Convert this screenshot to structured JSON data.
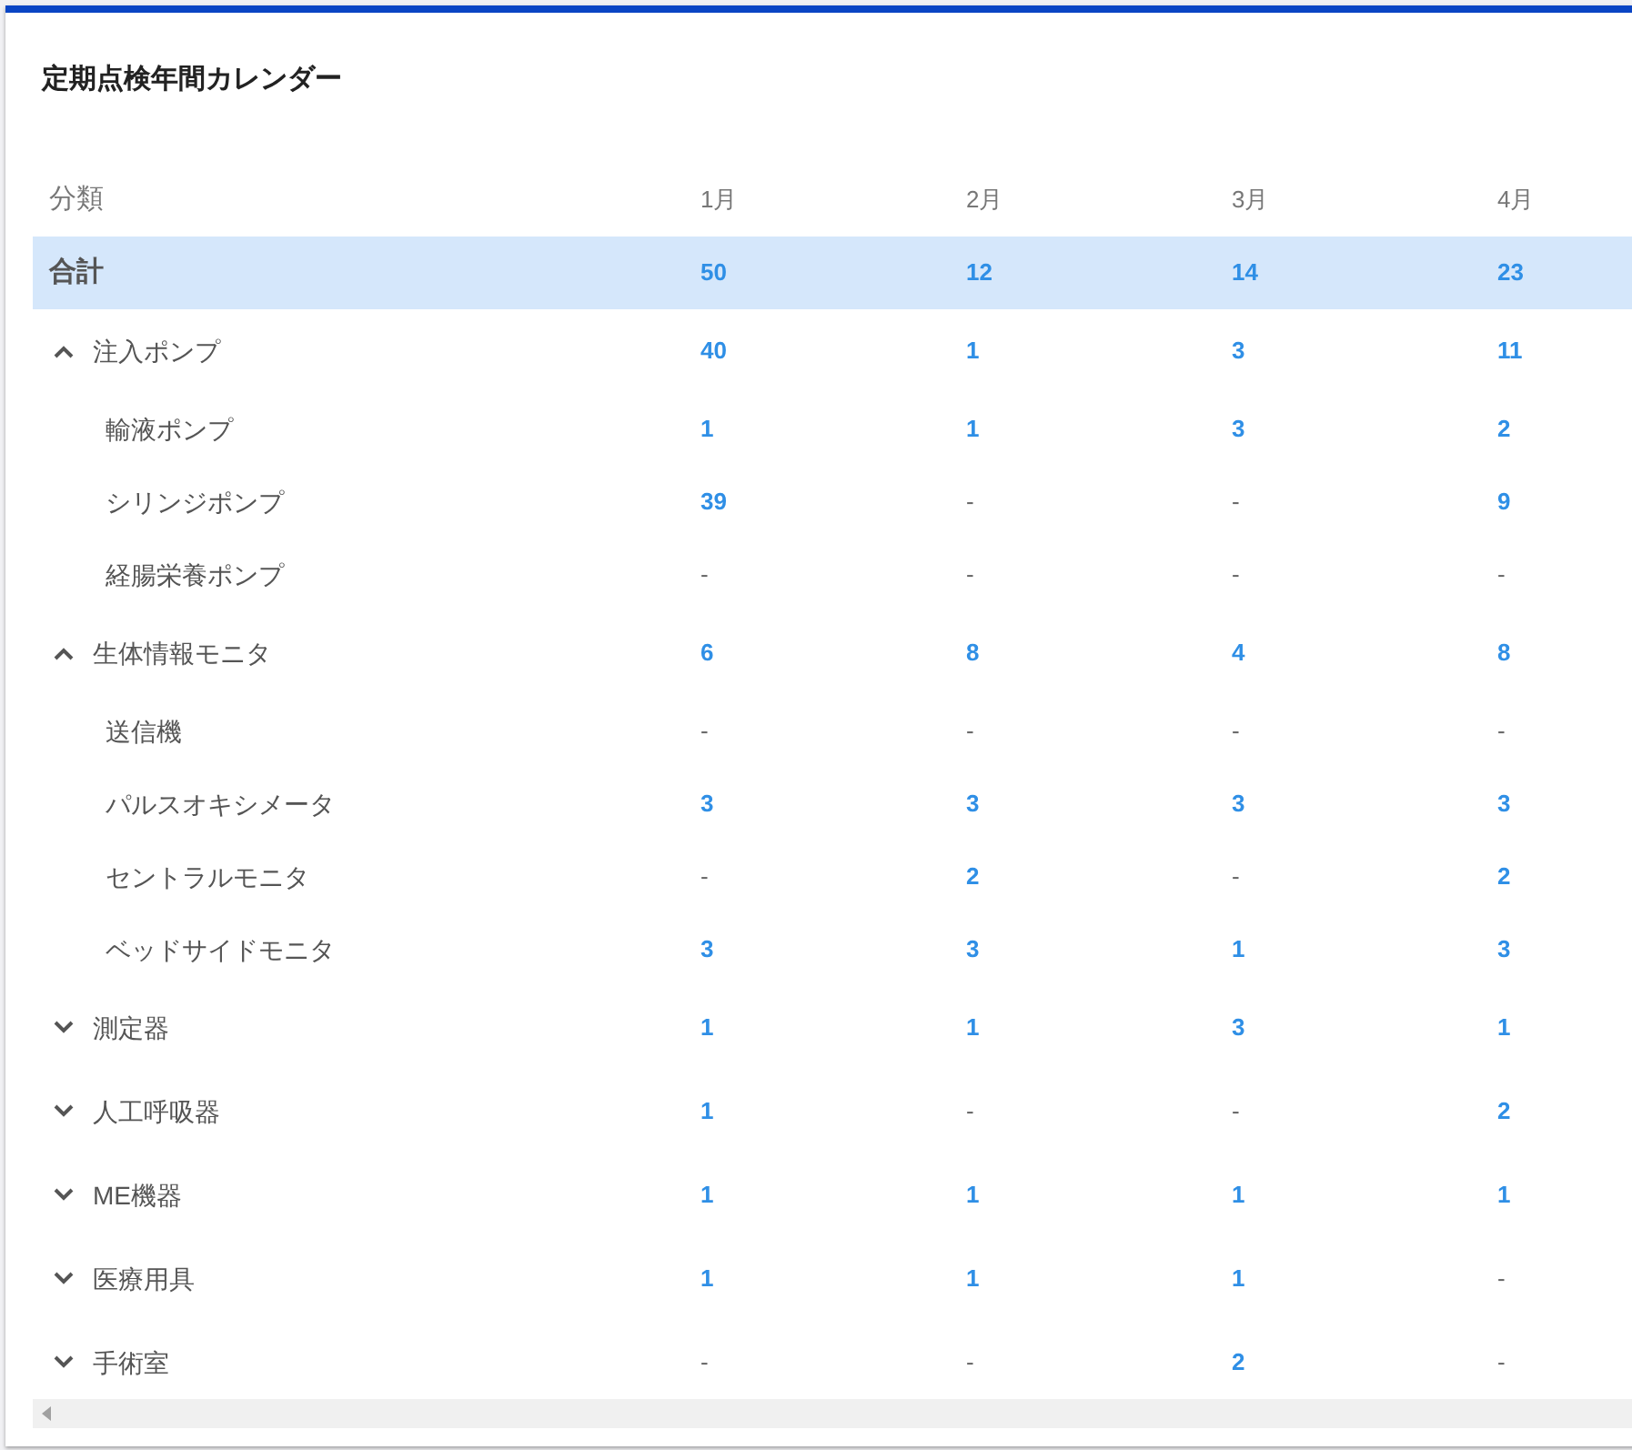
{
  "title": "定期点検年間カレンダー",
  "table": {
    "columns": [
      "分類",
      "1月",
      "2月",
      "3月",
      "4月"
    ],
    "total": {
      "label": "合計",
      "values": [
        "50",
        "12",
        "14",
        "23"
      ],
      "selected": true
    },
    "rows": [
      {
        "label": "注入ポンプ",
        "expanded": true,
        "values": [
          "40",
          "1",
          "3",
          "11"
        ],
        "children": [
          {
            "label": "輸液ポンプ",
            "values": [
              "1",
              "1",
              "3",
              "2"
            ]
          },
          {
            "label": "シリンジポンプ",
            "values": [
              "39",
              "-",
              "-",
              "9"
            ]
          },
          {
            "label": "経腸栄養ポンプ",
            "values": [
              "-",
              "-",
              "-",
              "-"
            ]
          }
        ]
      },
      {
        "label": "生体情報モニタ",
        "expanded": true,
        "values": [
          "6",
          "8",
          "4",
          "8"
        ],
        "children": [
          {
            "label": "送信機",
            "values": [
              "-",
              "-",
              "-",
              "-"
            ]
          },
          {
            "label": "パルスオキシメータ",
            "values": [
              "3",
              "3",
              "3",
              "3"
            ]
          },
          {
            "label": "セントラルモニタ",
            "values": [
              "-",
              "2",
              "-",
              "2"
            ]
          },
          {
            "label": "ベッドサイドモニタ",
            "values": [
              "3",
              "3",
              "1",
              "3"
            ]
          }
        ]
      },
      {
        "label": "測定器",
        "expanded": false,
        "values": [
          "1",
          "1",
          "3",
          "1"
        ]
      },
      {
        "label": "人工呼吸器",
        "expanded": false,
        "values": [
          "1",
          "-",
          "-",
          "2"
        ]
      },
      {
        "label": "ME機器",
        "expanded": false,
        "values": [
          "1",
          "1",
          "1",
          "1"
        ]
      },
      {
        "label": "医療用具",
        "expanded": false,
        "values": [
          "1",
          "1",
          "1",
          "-"
        ]
      },
      {
        "label": "手術室",
        "expanded": false,
        "values": [
          "-",
          "-",
          "2",
          "-"
        ]
      }
    ]
  }
}
